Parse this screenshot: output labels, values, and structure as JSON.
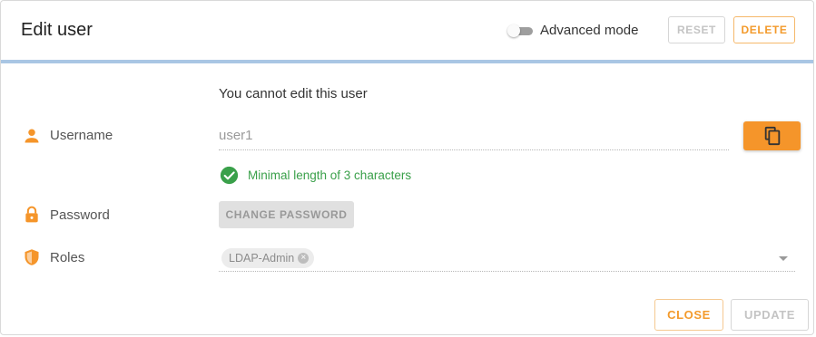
{
  "dialog": {
    "title": "Edit user",
    "advanced_mode_label": "Advanced mode",
    "advanced_mode_on": false,
    "reset_label": "RESET",
    "delete_label": "DELETE",
    "warning": "You cannot edit this user"
  },
  "form": {
    "username": {
      "label": "Username",
      "value": "user1",
      "icon": "person-icon",
      "validation": "Minimal length of 3 characters"
    },
    "password": {
      "label": "Password",
      "icon": "lock-icon",
      "change_label": "CHANGE PASSWORD"
    },
    "roles": {
      "label": "Roles",
      "icon": "shield-icon",
      "chips": [
        "LDAP-Admin"
      ]
    }
  },
  "footer": {
    "close_label": "CLOSE",
    "update_label": "UPDATE"
  },
  "colors": {
    "accent": "#f5952a",
    "success": "#3aa04a",
    "divider": "#a9c6e4"
  }
}
